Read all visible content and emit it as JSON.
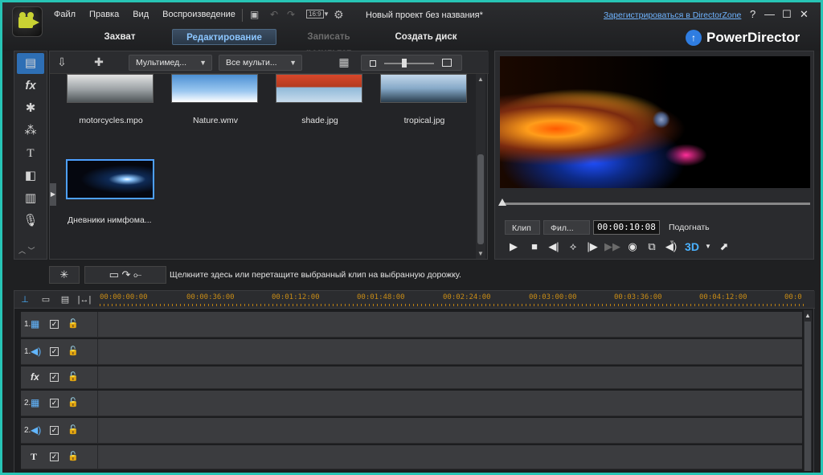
{
  "menu": {
    "items": [
      "Файл",
      "Правка",
      "Вид",
      "Воспроизведение"
    ]
  },
  "project_title": "Новый проект без названия*",
  "register_link": "Зарегистрироваться в DirectorZone",
  "aspect_badge": "16:9",
  "window_controls": {
    "help": "?",
    "minimize": "—",
    "maximize": "☐",
    "close": "✕"
  },
  "modes": {
    "capture": "Захват",
    "edit": "Редактирование",
    "produce": "Записать результат",
    "disc": "Создать диск"
  },
  "brand": {
    "name": "PowerDirector",
    "accent": "#2f7de1"
  },
  "library": {
    "filter1": "Мультимед...",
    "filter2": "Все мульти...",
    "items": [
      {
        "name": "motorcycles.mpo"
      },
      {
        "name": "Nature.wmv"
      },
      {
        "name": "shade.jpg"
      },
      {
        "name": "tropical.jpg"
      },
      {
        "name": "Дневники нимфома..."
      }
    ]
  },
  "player": {
    "clip_tab": "Клип",
    "film_tab": "Фил...",
    "timecode": "00:00:10:08",
    "fit_label": "Подогнать",
    "three_d": "3D",
    "seek_fraction": 0.0
  },
  "hint": "Щелкните здесь или перетащите выбранный клип на выбранную дорожку.",
  "timeline": {
    "ticks": [
      "00:00:00:00",
      "00:00:36:00",
      "00:01:12:00",
      "00:01:48:00",
      "00:02:24:00",
      "00:03:00:00",
      "00:03:36:00",
      "00:04:12:00",
      "00:0"
    ],
    "tracks": [
      {
        "index": "1.",
        "icon": "video-track-icon",
        "symbol": "▦",
        "checked": "✓",
        "lock": "🔓"
      },
      {
        "index": "1.",
        "icon": "audio-track-icon",
        "symbol": "◀)",
        "checked": "✓",
        "lock": "🔓"
      },
      {
        "index": "",
        "icon": "fx-track-icon",
        "symbol": "fx",
        "checked": "✓",
        "lock": "🔓"
      },
      {
        "index": "2.",
        "icon": "video-track-icon",
        "symbol": "▦",
        "checked": "✓",
        "lock": "🔓"
      },
      {
        "index": "2.",
        "icon": "audio-track-icon",
        "symbol": "◀)",
        "checked": "✓",
        "lock": "🔓"
      },
      {
        "index": "",
        "icon": "title-track-icon",
        "symbol": "T",
        "checked": "✓",
        "lock": "🔓"
      }
    ]
  }
}
